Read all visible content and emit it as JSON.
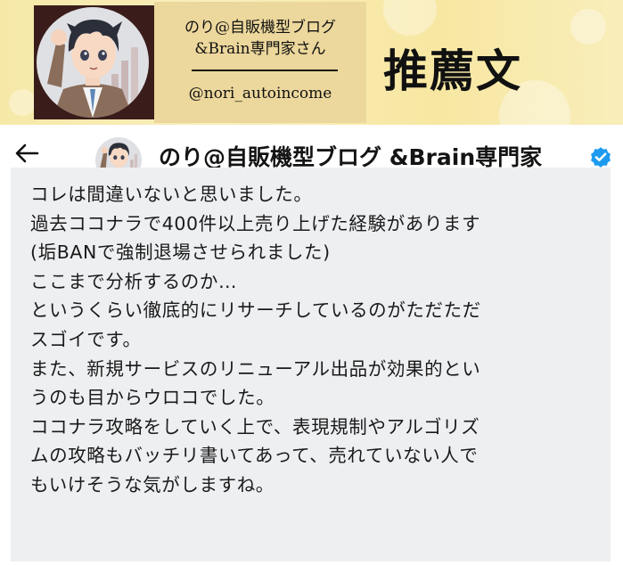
{
  "banner": {
    "name_line1": "のり@自販機型ブログ",
    "name_line2": "&Brain専門家さん",
    "handle": "@nori_autoincome",
    "title": "推薦文"
  },
  "header": {
    "account_name": "のり@自販機型ブログ &Brain専門家"
  },
  "tweet": {
    "lines": [
      "コレは間違いないと思いました。",
      "過去ココナラで400件以上売り上げた経験があります",
      "(垢BANで強制退場させられました)",
      "ここまで分析するのか…",
      "というくらい徹底的にリサーチしているのがただただ",
      "スゴイです。",
      "また、新規サービスのリニューアル出品が効果的とい",
      "うのも目からウロコでした。",
      "ココナラ攻略をしていく上で、表現規制やアルゴリズ",
      "ムの攻略もバッチリ書いてあって、売れていない人で",
      "もいけそうな気がしますね。"
    ]
  },
  "colors": {
    "banner_gold": "#f6e9a8",
    "name_card": "#ecd79c",
    "verified_blue": "#1d9bf0",
    "tweet_background": "#eeeff1"
  }
}
